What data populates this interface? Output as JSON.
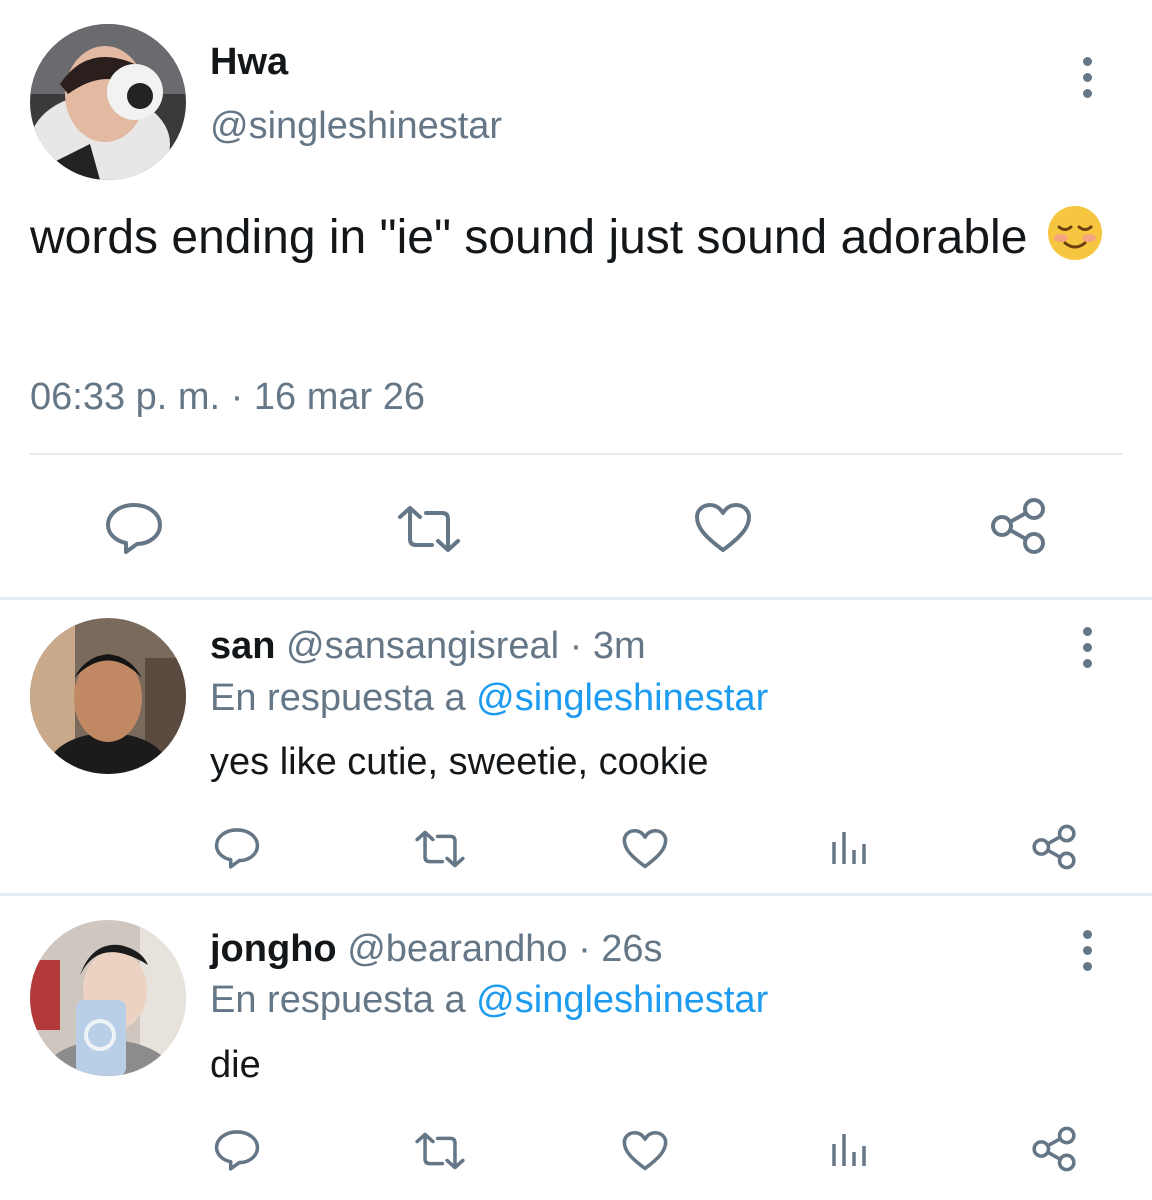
{
  "main_tweet": {
    "display_name": "Hwa",
    "handle": "@singleshinestar",
    "text": "words ending in \"ie\" sound just sound adorable",
    "emoji": "☺️",
    "timestamp": "06:33 p. m. · 16 mar 26",
    "actions": [
      "comment-icon",
      "retweet-icon",
      "heart-icon",
      "share-icon"
    ]
  },
  "replies": [
    {
      "display_name": "san",
      "handle": "@sansangisreal",
      "time": "· 3m",
      "reply_prefix": "En respuesta a",
      "reply_to": "@singleshinestar",
      "text": "yes like cutie, sweetie, cookie"
    },
    {
      "display_name": "jongho",
      "handle": "@bearandho",
      "time": "· 26s",
      "reply_prefix": "En respuesta a",
      "reply_to": "@singleshinestar",
      "text": "die"
    }
  ],
  "colors": {
    "accent": "#1d9bf0",
    "secondary_text": "#657786",
    "icon": "#657786",
    "divider": "#e6ecf0"
  }
}
